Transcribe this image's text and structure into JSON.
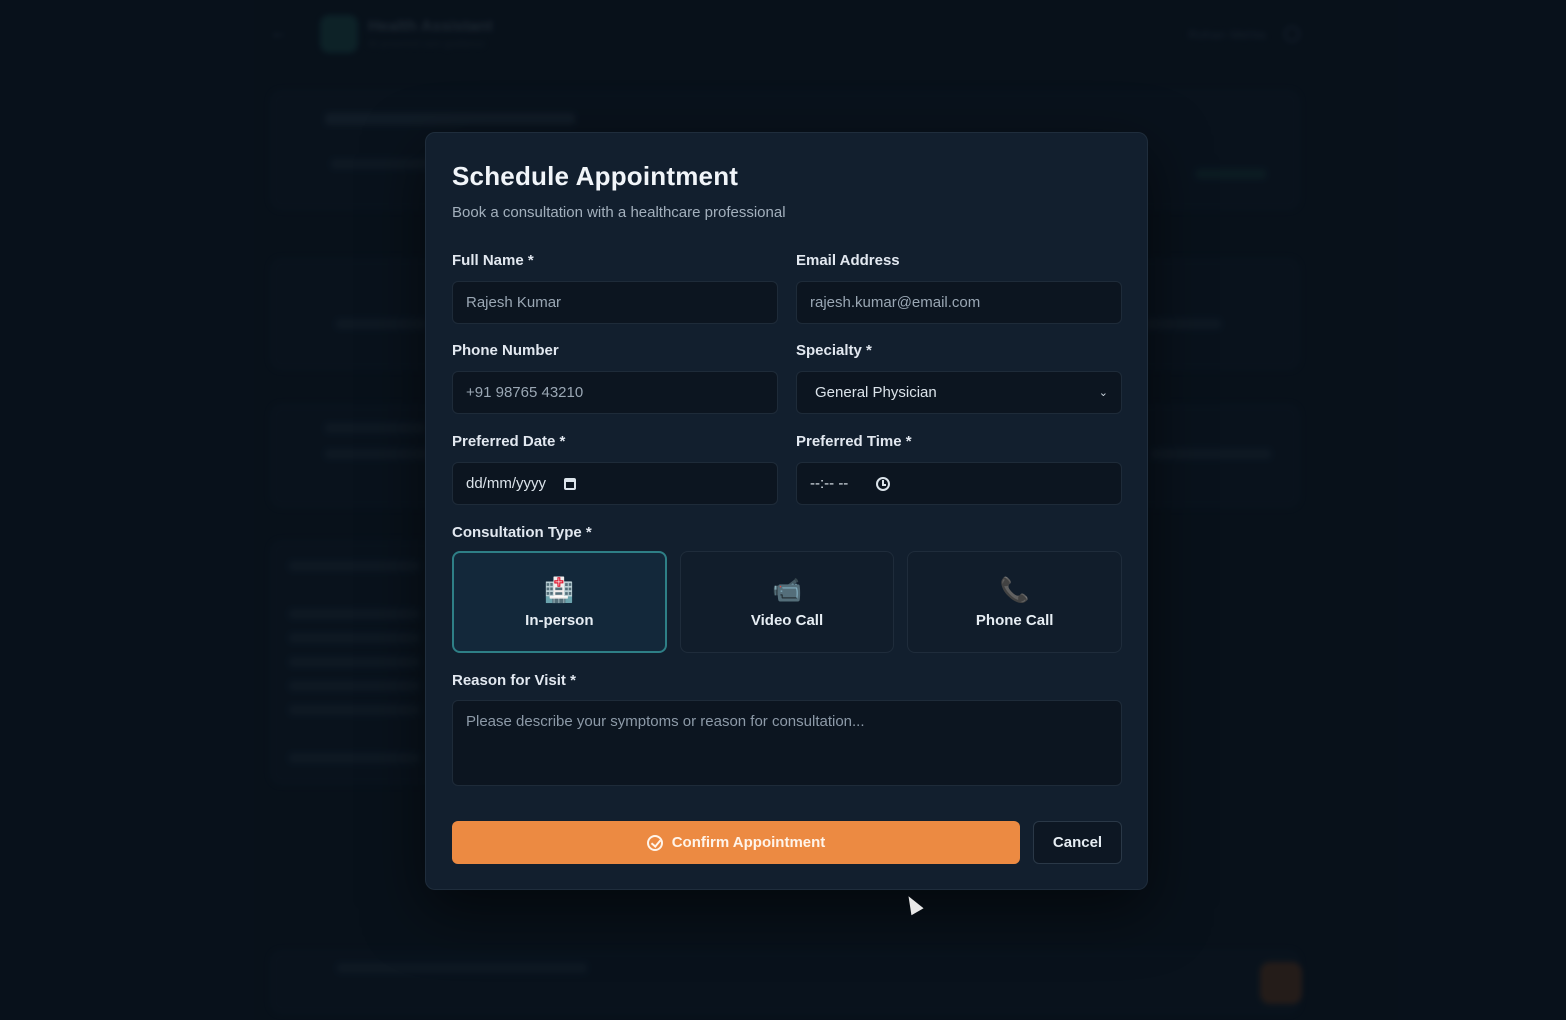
{
  "background": {
    "app_title": "Health Assistant",
    "app_subtitle": "AI-powered care guidance",
    "user_name": "Rohan Mehta",
    "section_title": "Your Upcoming Appointments"
  },
  "modal": {
    "title": "Schedule Appointment",
    "subtitle": "Book a consultation with a healthcare professional",
    "fields": {
      "full_name": {
        "label": "Full Name *",
        "value": "Rajesh Kumar"
      },
      "email": {
        "label": "Email Address",
        "value": "rajesh.kumar@email.com"
      },
      "phone": {
        "label": "Phone Number",
        "value": "+91 98765 43210"
      },
      "specialty": {
        "label": "Specialty *",
        "value": "General Physician"
      },
      "date": {
        "label": "Preferred Date *",
        "placeholder": "dd/mm/yyyy"
      },
      "time": {
        "label": "Preferred Time *",
        "placeholder": "--:-- --"
      }
    },
    "consultation": {
      "label": "Consultation Type *",
      "options": [
        {
          "label": "In-person",
          "icon": "hospital-icon",
          "glyph": "🏥",
          "selected": true
        },
        {
          "label": "Video Call",
          "icon": "video-camera-icon",
          "glyph": "📹",
          "selected": false
        },
        {
          "label": "Phone Call",
          "icon": "phone-icon",
          "glyph": "📞",
          "selected": false
        }
      ]
    },
    "reason": {
      "label": "Reason for Visit *",
      "placeholder": "Please describe your symptoms or reason for consultation..."
    },
    "buttons": {
      "confirm": "Confirm Appointment",
      "cancel": "Cancel"
    }
  },
  "colors": {
    "accent": "#ec8a42",
    "selected_border": "#2e7f86",
    "modal_bg": "#121f2e",
    "page_bg": "#0b1622"
  }
}
